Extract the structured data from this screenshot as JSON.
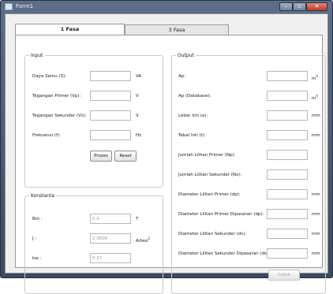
{
  "window": {
    "title": "Form1",
    "minimize_glyph": "–",
    "maximize_glyph": "▫",
    "close_glyph": "✕"
  },
  "tabs": [
    {
      "label": "1 Fasa",
      "active": true
    },
    {
      "label": "3 Fasa",
      "active": false
    }
  ],
  "input": {
    "legend": "Input",
    "fields": [
      {
        "label": "Daya Semu (S):",
        "value": "",
        "unit": "VA"
      },
      {
        "label": "Tegangan Primer (Vp):",
        "value": "",
        "unit": "V"
      },
      {
        "label": "Tegangan Sekunder (Vs):",
        "value": "",
        "unit": "V"
      },
      {
        "label": "Frekuensi (f):",
        "value": "",
        "unit": "Hz"
      }
    ],
    "process_label": "Proses",
    "reset_label": "Reset"
  },
  "konstanta": {
    "legend": "Konstanta",
    "bm": {
      "label": "Bm :",
      "value": "0.9",
      "unit": "T"
    },
    "j": {
      "label": "J :",
      "value": "2.3E06",
      "unit": "A/tesi",
      "unit_sup": "2"
    },
    "kw": {
      "label": "kw :",
      "value": "0.27"
    }
  },
  "output": {
    "legend": "Output",
    "fields": [
      {
        "label": "Ap:",
        "unit": "m",
        "unit_sup": "4"
      },
      {
        "label": "Ap (Database):",
        "unit": "m",
        "unit_sup": "4"
      },
      {
        "label": "Lebar Inti (a):",
        "unit": "mm",
        "unit_sup": ""
      },
      {
        "label": "Tebal Inti (t):",
        "unit": "mm",
        "unit_sup": ""
      },
      {
        "label": "Jumlah Lilitan Primer (Np):",
        "unit": "",
        "unit_sup": ""
      },
      {
        "label": "Jumlah Lilitan Sekunder (Ns):",
        "unit": "",
        "unit_sup": ""
      },
      {
        "label": "Diameter Lilitan Primer (dp):",
        "unit": "mm",
        "unit_sup": ""
      },
      {
        "label": "Diameter Lilitan Primer Dipasaran (dp):",
        "unit": "mm",
        "unit_sup": ""
      },
      {
        "label": "Diameter Lilitan Sekunder (ds):",
        "unit": "mm",
        "unit_sup": ""
      },
      {
        "label": "Diameter Lilitan Sekunder Dipasaran (ds):",
        "unit": "mm",
        "unit_sup": ""
      }
    ],
    "print_label": "Cetak"
  }
}
